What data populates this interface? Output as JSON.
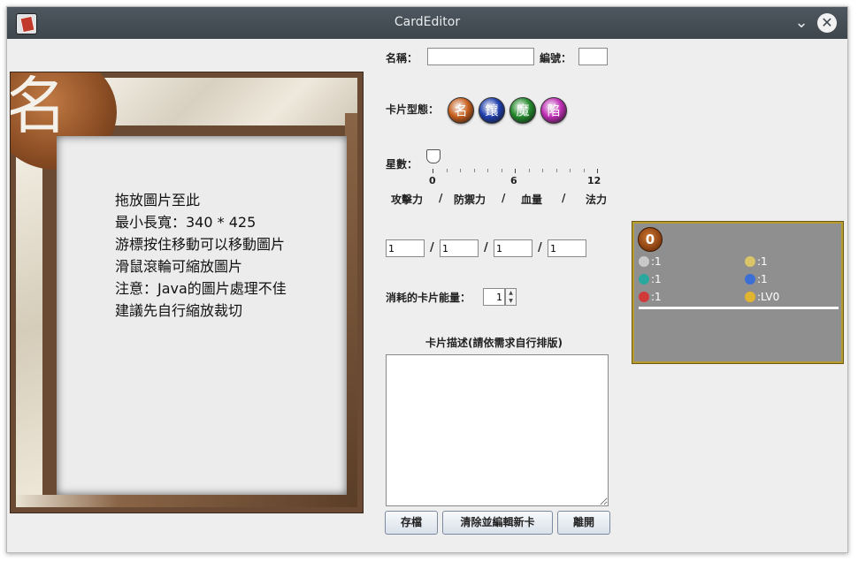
{
  "window": {
    "title": "CardEditor"
  },
  "card": {
    "orb_glyph": "名",
    "instructions": [
      "拖放圖片至此",
      "最小長寬：340 * 425",
      "游標按住移動可以移動圖片",
      "滑鼠滾輪可縮放圖片",
      "注意：Java的圖片處理不佳",
      "建議先自行縮放裁切"
    ]
  },
  "form": {
    "name_label": "名稱：",
    "name_value": "",
    "number_label": "編號：",
    "number_value": "",
    "card_type_label": "卡片型態：",
    "card_types": [
      {
        "glyph": "名",
        "color": "#c8601e"
      },
      {
        "glyph": "鑲",
        "color": "#1f3fae"
      },
      {
        "glyph": "魔",
        "color": "#238a2c"
      },
      {
        "glyph": "陷",
        "color": "#c12fb7"
      }
    ],
    "stars_label": "星數：",
    "stars_value": 0,
    "stars_ticks": [
      "0",
      "6",
      "12"
    ],
    "stat_headers": [
      "攻擊力",
      "/",
      "防禦力",
      "/",
      "血量",
      "/",
      "法力"
    ],
    "stat_values": [
      "1",
      "1",
      "1",
      "1"
    ],
    "stat_separator": "/",
    "energy_label": "消耗的卡片能量：",
    "energy_value": "1",
    "desc_label": "卡片描述(請依需求自行排版)",
    "desc_value": "",
    "buttons": {
      "save": "存檔",
      "clear": "清除並編輯新卡",
      "exit": "離開"
    }
  },
  "preview": {
    "cost": "0",
    "stats": [
      {
        "icon": "sword-icon",
        "text": ":1",
        "color": "#c9c9c9"
      },
      {
        "icon": "shield-icon",
        "text": ":1",
        "color": "#d9c56a"
      },
      {
        "icon": "mana-gem-icon",
        "text": ":1",
        "color": "#2aa8a0"
      },
      {
        "icon": "blue-gem-icon",
        "text": ":1",
        "color": "#3b6fd4"
      },
      {
        "icon": "health-icon",
        "text": ":1",
        "color": "#d23a3a"
      },
      {
        "icon": "lock-icon",
        "text": ":LV0",
        "color": "#e2b530"
      }
    ]
  }
}
